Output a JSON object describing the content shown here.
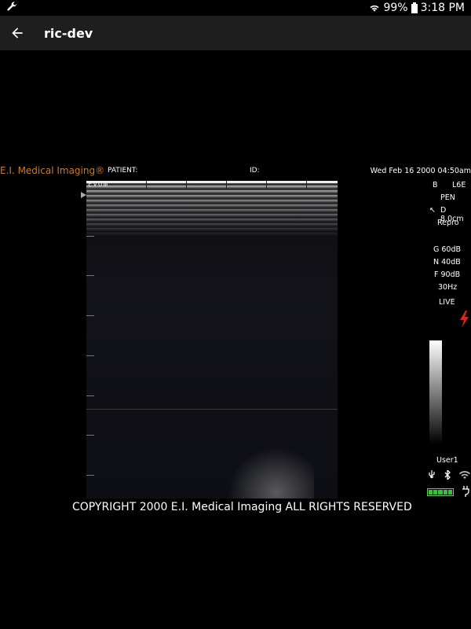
{
  "status_bar": {
    "battery_percent": "99%",
    "time": "3:18 PM"
  },
  "app_bar": {
    "title": "ric-dev"
  },
  "ultrasound": {
    "brand": "E.I. Medical Imaging®",
    "patient_label": "PATIENT:",
    "id_label": "ID:",
    "datetime": "Wed Feb 16 2000 04:50am",
    "logo_text": "EVOⅢ",
    "params": {
      "mode": "B",
      "probe": "L6E",
      "preset": "PEN",
      "depth": "D 8.0cm",
      "repro": "Repro",
      "gain": "G 60dB",
      "near_gain": "N 40dB",
      "far_gain": "F 90dB",
      "frame_rate": "30Hz",
      "state": "LIVE"
    },
    "user": "User1",
    "battery_level": 1.0,
    "copyright": "COPYRIGHT 2000 E.I. Medical Imaging ALL RIGHTS RESERVED"
  },
  "colors": {
    "brand": "#c77b32",
    "lightning": "#e02020",
    "battery": "#3fbf3f"
  }
}
